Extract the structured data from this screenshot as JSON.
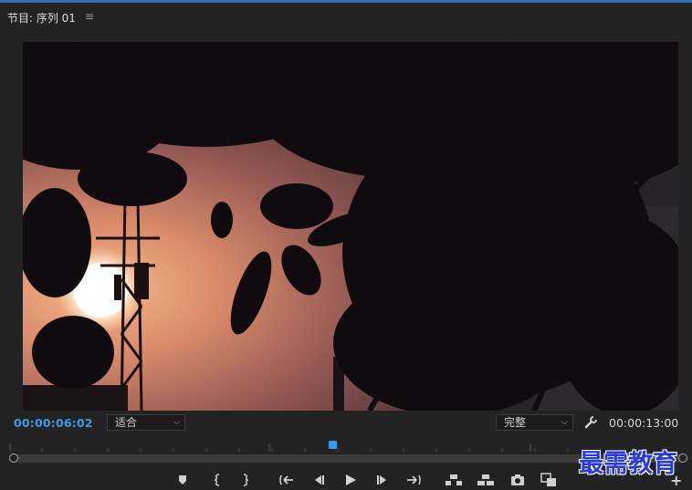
{
  "panel": {
    "title": "节目: 序列 01",
    "menu_icon": "hamburger-menu-icon"
  },
  "timecode": {
    "current": "00:00:06:02",
    "duration": "00:00:13:00"
  },
  "colors": {
    "accent": "#3d9ae8",
    "top_bar": "#2f6fb5",
    "panel_bg": "#232323"
  },
  "fit_select": {
    "value": "适合"
  },
  "quality_select": {
    "value": "完整"
  },
  "settings_icon": "wrench-icon",
  "playhead": {
    "fraction": 0.48
  },
  "transport_icons": [
    "add-marker-icon",
    "mark-in-icon",
    "mark-out-icon",
    "go-to-in-icon",
    "step-back-icon",
    "play-icon",
    "step-forward-icon",
    "go-to-out-icon",
    "lift-icon",
    "extract-icon",
    "export-frame-icon",
    "comparison-view-icon"
  ],
  "add_button_icon": "plus-icon",
  "watermark": "最需教育"
}
